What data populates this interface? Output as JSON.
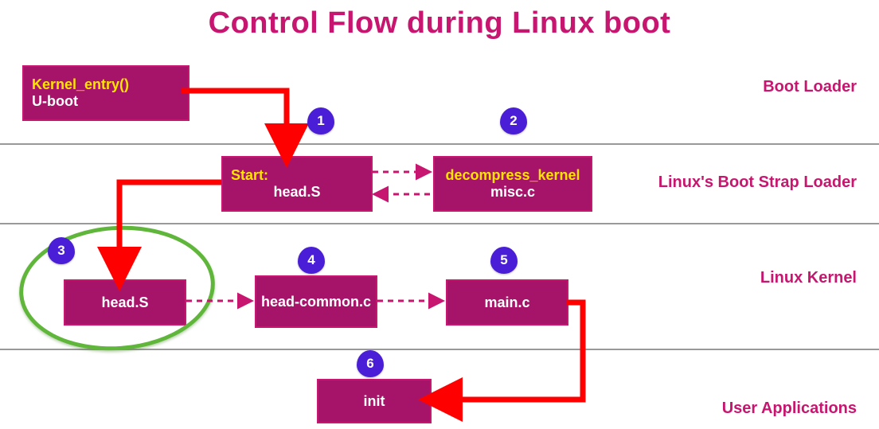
{
  "title": "Control Flow during Linux boot",
  "sections": {
    "boot_loader": "Boot Loader",
    "bootstrap": "Linux's Boot Strap Loader",
    "kernel": "Linux Kernel",
    "user": "User Applications"
  },
  "badges": {
    "b1": "1",
    "b2": "2",
    "b3": "3",
    "b4": "4",
    "b5": "5",
    "b6": "6"
  },
  "nodes": {
    "uboot": {
      "accent": "Kernel_entry()",
      "label": "U-boot"
    },
    "headS1": {
      "accent": "Start:",
      "label": "head.S"
    },
    "misc": {
      "accent": "decompress_kernel",
      "label": "misc.c"
    },
    "headS2": {
      "label": "head.S"
    },
    "headcommon": {
      "label": "head-common.c"
    },
    "mainc": {
      "label": "main.c"
    },
    "init": {
      "label": "init"
    }
  },
  "chart_data": {
    "type": "flow-diagram",
    "title": "Control Flow during Linux boot",
    "lanes": [
      {
        "name": "Boot Loader",
        "nodes": [
          "uboot"
        ]
      },
      {
        "name": "Linux's Boot Strap Loader",
        "nodes": [
          "headS1",
          "misc"
        ]
      },
      {
        "name": "Linux Kernel",
        "nodes": [
          "headS2",
          "headcommon",
          "mainc"
        ]
      },
      {
        "name": "User Applications",
        "nodes": [
          "init"
        ]
      }
    ],
    "nodes": {
      "uboot": {
        "label": "U-boot",
        "accent": "Kernel_entry()"
      },
      "headS1": {
        "label": "head.S",
        "accent": "Start:"
      },
      "misc": {
        "label": "misc.c",
        "accent": "decompress_kernel"
      },
      "headS2": {
        "label": "head.S"
      },
      "headcommon": {
        "label": "head-common.c"
      },
      "mainc": {
        "label": "main.c"
      },
      "init": {
        "label": "init"
      }
    },
    "edges": [
      {
        "from": "uboot",
        "to": "headS1",
        "style": "solid",
        "badge": 1
      },
      {
        "from": "headS1",
        "to": "misc",
        "style": "dashed-bidir",
        "badge": 2
      },
      {
        "from": "headS1",
        "to": "headS2",
        "style": "solid",
        "badge": 3
      },
      {
        "from": "headS2",
        "to": "headcommon",
        "style": "dashed",
        "badge": 4
      },
      {
        "from": "headcommon",
        "to": "mainc",
        "style": "dashed",
        "badge": 5
      },
      {
        "from": "mainc",
        "to": "init",
        "style": "solid",
        "badge": 6
      }
    ],
    "highlight": {
      "node": "headS2",
      "style": "green-ellipse"
    }
  }
}
